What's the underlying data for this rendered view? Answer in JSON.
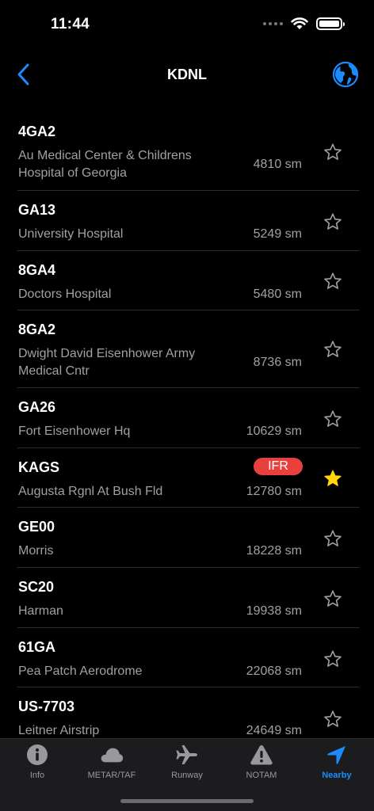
{
  "status_bar": {
    "time": "11:44"
  },
  "nav": {
    "title": "KDNL"
  },
  "airports": [
    {
      "code": "4GA2",
      "name": "Au Medical Center & Childrens Hospital of Georgia",
      "distance": "4810 sm",
      "favorite": false,
      "badge": ""
    },
    {
      "code": "GA13",
      "name": "University Hospital",
      "distance": "5249 sm",
      "favorite": false,
      "badge": ""
    },
    {
      "code": "8GA4",
      "name": "Doctors Hospital",
      "distance": "5480 sm",
      "favorite": false,
      "badge": ""
    },
    {
      "code": "8GA2",
      "name": "Dwight David Eisenhower Army Medical Cntr",
      "distance": "8736 sm",
      "favorite": false,
      "badge": ""
    },
    {
      "code": "GA26",
      "name": "Fort Eisenhower Hq",
      "distance": "10629 sm",
      "favorite": false,
      "badge": ""
    },
    {
      "code": "KAGS",
      "name": "Augusta Rgnl At Bush Fld",
      "distance": "12780 sm",
      "favorite": true,
      "badge": "IFR"
    },
    {
      "code": "GE00",
      "name": "Morris",
      "distance": "18228 sm",
      "favorite": false,
      "badge": ""
    },
    {
      "code": "SC20",
      "name": "Harman",
      "distance": "19938 sm",
      "favorite": false,
      "badge": ""
    },
    {
      "code": "61GA",
      "name": "Pea Patch Aerodrome",
      "distance": "22068 sm",
      "favorite": false,
      "badge": ""
    },
    {
      "code": "US-7703",
      "name": "Leitner Airstrip",
      "distance": "24649 sm",
      "favorite": false,
      "badge": ""
    }
  ],
  "tabs": [
    {
      "label": "Info",
      "icon": "info-circle-icon"
    },
    {
      "label": "METAR/TAF",
      "icon": "cloud-icon"
    },
    {
      "label": "Runway",
      "icon": "airplane-icon"
    },
    {
      "label": "NOTAM",
      "icon": "warning-triangle-icon"
    },
    {
      "label": "Nearby",
      "icon": "location-arrow-icon"
    }
  ],
  "active_tab": "Nearby",
  "colors": {
    "accent": "#1a8cff",
    "favorite_star": "#ffd60a",
    "ifr_badge": "#e8403d",
    "background": "#000000",
    "secondary_text": "#a0a0a5"
  }
}
